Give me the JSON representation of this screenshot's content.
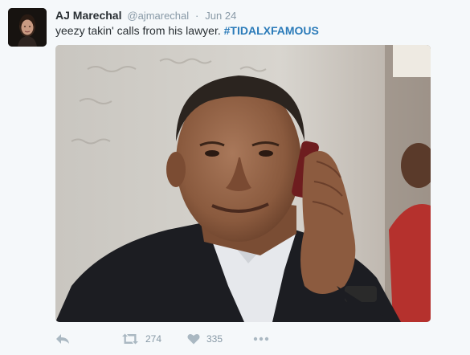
{
  "tweet": {
    "name": "AJ Marechal",
    "handle": "@ajmarechal",
    "separator": "·",
    "date": "Jun 24",
    "text": "yeezy takin' calls from his lawyer.",
    "hashtag": "#TIDALXFAMOUS"
  },
  "actions": {
    "retweet_count": "274",
    "like_count": "335"
  },
  "icons": {
    "reply": "reply-icon",
    "retweet": "retweet-icon",
    "like": "heart-icon",
    "more": "more-dots-icon"
  },
  "colors": {
    "background": "#f5f8fa",
    "name": "#292f33",
    "meta": "#8899a6",
    "hashtag": "#2b7bb9",
    "action_icon": "#aab8c2"
  }
}
